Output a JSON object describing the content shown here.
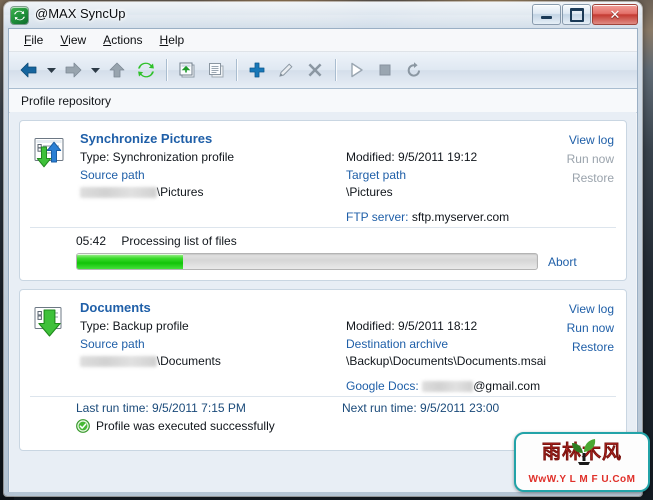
{
  "window": {
    "title": "@MAX SyncUp",
    "app_icon": "sync-app-icon",
    "controls": {
      "minimize": "minimize-button",
      "maximize": "maximize-button",
      "close_label": "✕"
    }
  },
  "menu": {
    "items": [
      {
        "name": "file",
        "accel": "F",
        "rest": "ile"
      },
      {
        "name": "view",
        "accel": "V",
        "rest": "iew"
      },
      {
        "name": "actions",
        "accel": "A",
        "rest": "ctions"
      },
      {
        "name": "help",
        "accel": "H",
        "rest": "elp"
      }
    ]
  },
  "toolbar": {
    "buttons": [
      {
        "name": "back-button",
        "icon": "arrow-left-icon",
        "tooltip": "Back"
      },
      {
        "name": "back-dropdown",
        "icon": "chevron-down-icon",
        "tooltip": "Back history"
      },
      {
        "name": "forward-button",
        "icon": "arrow-right-icon",
        "tooltip": "Forward"
      },
      {
        "name": "forward-dropdown",
        "icon": "chevron-down-icon",
        "tooltip": "Forward history"
      },
      {
        "name": "up-button",
        "icon": "arrow-up-icon",
        "tooltip": "Up"
      },
      {
        "name": "refresh-button",
        "icon": "refresh-icon",
        "tooltip": "Refresh"
      },
      {
        "name": "import-profile-button",
        "icon": "import-icon",
        "tooltip": "Import profile"
      },
      {
        "name": "copy-profile-button",
        "icon": "copy-icon",
        "tooltip": "Copy profile"
      },
      {
        "name": "add-profile-button",
        "icon": "plus-icon",
        "tooltip": "Add profile"
      },
      {
        "name": "edit-profile-button",
        "icon": "pencil-icon",
        "tooltip": "Edit profile"
      },
      {
        "name": "delete-profile-button",
        "icon": "delete-x-icon",
        "tooltip": "Delete profile"
      },
      {
        "name": "run-button",
        "icon": "play-icon",
        "tooltip": "Run"
      },
      {
        "name": "stop-button",
        "icon": "stop-icon",
        "tooltip": "Stop"
      },
      {
        "name": "restore-button",
        "icon": "restore-undo-icon",
        "tooltip": "Restore"
      }
    ]
  },
  "repository": {
    "header": "Profile repository"
  },
  "profiles": [
    {
      "icon": "sync-profile-icon",
      "title": "Synchronize Pictures",
      "type": "Type: Synchronization profile",
      "source_label": "Source path",
      "source_value_redacted": "C:\\Users\\DMa",
      "source_value": "\\Pictures",
      "modified": "Modified: 9/5/2011 19:12",
      "target_label": "Target path",
      "target_value": "\\Pictures",
      "extra_label": "FTP server:",
      "extra_value": "sftp.myserver.com",
      "actions": [
        {
          "name": "view-log-link",
          "label": "View log",
          "disabled": false
        },
        {
          "name": "run-now-link",
          "label": "Run now",
          "disabled": true
        },
        {
          "name": "restore-link",
          "label": "Restore",
          "disabled": true
        }
      ],
      "progress": {
        "elapsed": "05:42",
        "status": "Processing list of files",
        "percent": 23,
        "abort_label": "Abort"
      }
    },
    {
      "icon": "backup-profile-icon",
      "title": "Documents",
      "type": "Type: Backup profile",
      "source_label": "Source path",
      "source_value_redacted": "C:\\Users\\DMa",
      "source_value": "\\Documents",
      "modified": "Modified: 9/5/2011 18:12",
      "target_label": "Destination archive",
      "target_value": "\\Backup\\Documents\\Documents.msai",
      "extra_label": "Google Docs:",
      "extra_value_redacted": "andy.hun",
      "extra_value": "@gmail.com",
      "actions": [
        {
          "name": "view-log-link",
          "label": "View log",
          "disabled": false
        },
        {
          "name": "run-now-link",
          "label": "Run now",
          "disabled": false
        },
        {
          "name": "restore-link",
          "label": "Restore",
          "disabled": false
        }
      ],
      "status": {
        "last_run": "Last run time: 9/5/2011 7:15 PM",
        "next_run": "Next run time: 9/5/2011 23:00",
        "result_icon": "success-check-icon",
        "result": "Profile was executed successfully"
      }
    }
  ],
  "watermark": {
    "cn": "雨林木风",
    "url": "WwW.Y L M F U.CoM"
  },
  "colors": {
    "link": "#1f5fa8",
    "link_disabled": "#9aa3ac",
    "progress_green": "#12c408",
    "accent_red": "#e0302a"
  }
}
